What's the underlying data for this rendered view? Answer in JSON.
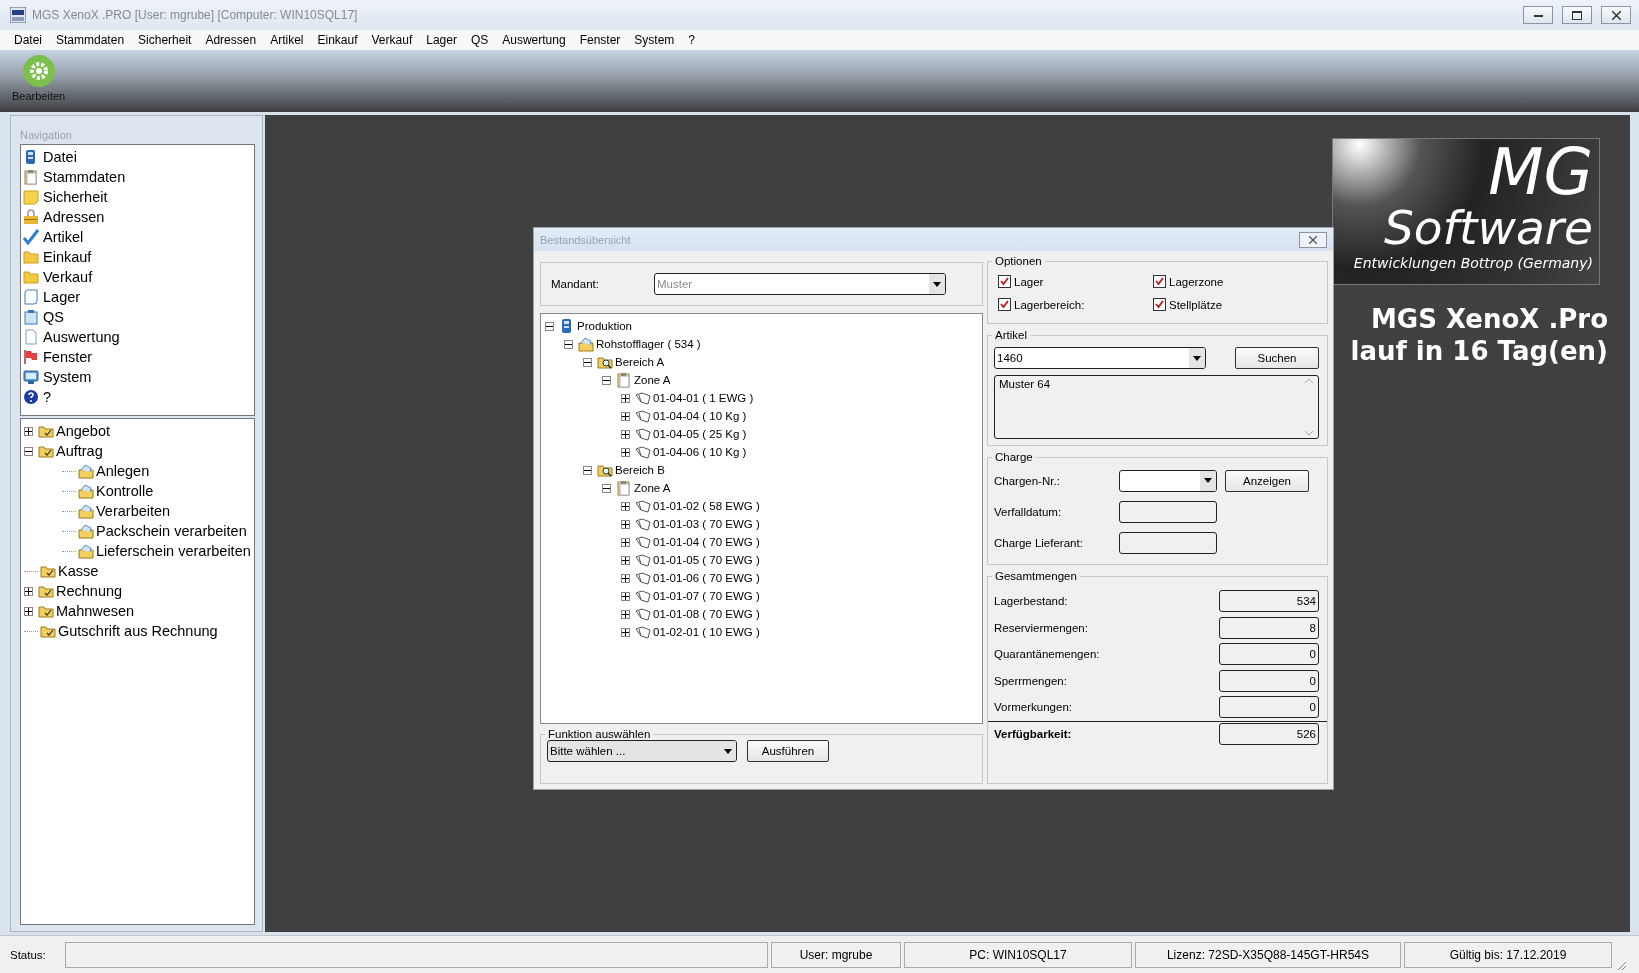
{
  "window": {
    "title": "MGS XenoX .PRO [User: mgrube] [Computer: WIN10SQL17]"
  },
  "menu": [
    {
      "label": "Datei"
    },
    {
      "label": "Stammdaten"
    },
    {
      "label": "Sicherheit"
    },
    {
      "label": "Adressen"
    },
    {
      "label": "Artikel"
    },
    {
      "label": "Einkauf"
    },
    {
      "label": "Verkauf"
    },
    {
      "label": "Lager"
    },
    {
      "label": "QS"
    },
    {
      "label": "Auswertung"
    },
    {
      "label": "Fenster"
    },
    {
      "label": "System"
    },
    {
      "label": "?"
    }
  ],
  "toolbar": [
    {
      "label": "Bearbeiten",
      "kind": "gear"
    }
  ],
  "navigation": {
    "title": "Navigation",
    "items": [
      {
        "label": "Datei",
        "kind": "database"
      },
      {
        "label": "Stammdaten",
        "kind": "clipboard"
      },
      {
        "label": "Sicherheit",
        "kind": "note"
      },
      {
        "label": "Adressen",
        "kind": "lock"
      },
      {
        "label": "Artikel",
        "kind": "check"
      },
      {
        "label": "Einkauf",
        "kind": "folder"
      },
      {
        "label": "Verkauf",
        "kind": "folder"
      },
      {
        "label": "Lager",
        "kind": "scroll"
      },
      {
        "label": "QS",
        "kind": "board"
      },
      {
        "label": "Auswertung",
        "kind": "document"
      },
      {
        "label": "Fenster",
        "kind": "flag"
      },
      {
        "label": "System",
        "kind": "monitor"
      },
      {
        "label": "?",
        "kind": "help"
      }
    ],
    "tree": [
      {
        "label": "Angebot",
        "kind": "folder-check",
        "expanded": false
      },
      {
        "label": "Auftrag",
        "kind": "folder-check",
        "expanded": true,
        "children": [
          {
            "label": "Anlegen",
            "kind": "envelope"
          },
          {
            "label": "Kontrolle",
            "kind": "envelope"
          },
          {
            "label": "Verarbeiten",
            "kind": "envelope"
          },
          {
            "label": "Packschein verarbeiten",
            "kind": "envelope"
          },
          {
            "label": "Lieferschein verarbeiten",
            "kind": "envelope"
          }
        ]
      },
      {
        "label": "Kasse",
        "kind": "folder-check"
      },
      {
        "label": "Rechnung",
        "kind": "folder-check",
        "expanded": false
      },
      {
        "label": "Mahnwesen",
        "kind": "folder-check",
        "expanded": false
      },
      {
        "label": "Gutschrift aus Rechnung",
        "kind": "folder-check"
      }
    ]
  },
  "logo": {
    "line_1": "MG",
    "line_2": "Software",
    "tagline": "Entwicklungen Bottrop (Germany)"
  },
  "banner": [
    "MGS XenoX .Pro",
    "lauf in 16 Tag(en)"
  ],
  "dialog": {
    "title": "Bestandsübersicht",
    "mandant": {
      "label": "Mandant:",
      "value": "Muster",
      "disabled": true
    },
    "tree": [
      {
        "label": "Produktion",
        "kind": "database",
        "expanded": true,
        "children": [
          {
            "label": "Rohstofflager ( 534 )",
            "kind": "envelope",
            "expanded": true,
            "children": [
              {
                "label": "Bereich A",
                "kind": "folder-search",
                "expanded": true,
                "children": [
                  {
                    "label": "Zone A",
                    "kind": "clipboard",
                    "expanded": true,
                    "children": [
                      {
                        "label": "01-04-01 ( 1 EWG )",
                        "kind": "book",
                        "expanded": false
                      },
                      {
                        "label": "01-04-04 ( 10 Kg )",
                        "kind": "book",
                        "expanded": false
                      },
                      {
                        "label": "01-04-05 ( 25 Kg )",
                        "kind": "book",
                        "expanded": false
                      },
                      {
                        "label": "01-04-06 ( 10 Kg )",
                        "kind": "book",
                        "expanded": false
                      }
                    ]
                  }
                ]
              },
              {
                "label": "Bereich B",
                "kind": "folder-search",
                "expanded": true,
                "children": [
                  {
                    "label": "Zone A",
                    "kind": "clipboard",
                    "expanded": true,
                    "children": [
                      {
                        "label": "01-01-02 ( 58 EWG )",
                        "kind": "book",
                        "expanded": false
                      },
                      {
                        "label": "01-01-03 ( 70 EWG )",
                        "kind": "book",
                        "expanded": false
                      },
                      {
                        "label": "01-01-04 ( 70 EWG )",
                        "kind": "book",
                        "expanded": false
                      },
                      {
                        "label": "01-01-05 ( 70 EWG )",
                        "kind": "book",
                        "expanded": false
                      },
                      {
                        "label": "01-01-06 ( 70 EWG )",
                        "kind": "book",
                        "expanded": false
                      },
                      {
                        "label": "01-01-07 ( 70 EWG )",
                        "kind": "book",
                        "expanded": false
                      },
                      {
                        "label": "01-01-08 ( 70 EWG )",
                        "kind": "book",
                        "expanded": false
                      },
                      {
                        "label": "01-02-01 ( 10 EWG )",
                        "kind": "book",
                        "expanded": false
                      }
                    ]
                  }
                ]
              }
            ]
          }
        ]
      }
    ],
    "function": {
      "legend": "Funktion auswählen",
      "value": "Bitte wählen ...",
      "button": "Ausführen"
    },
    "options": {
      "legend": "Optionen",
      "items": [
        {
          "label": "Lager",
          "checked": true
        },
        {
          "label": "Lagerzone",
          "checked": true
        },
        {
          "label": "Lagerbereich:",
          "checked": true
        },
        {
          "label": "Stellplätze",
          "checked": true
        }
      ]
    },
    "article": {
      "legend": "Artikel",
      "value": "1460",
      "button": "Suchen",
      "description": "Muster 64"
    },
    "charge": {
      "legend": "Charge",
      "rows": [
        {
          "label": "Chargen-Nr.:",
          "kind": "combo",
          "button": "Anzeigen"
        },
        {
          "label": "Verfalldatum:",
          "kind": "text"
        },
        {
          "label": "Charge Lieferant:",
          "kind": "text"
        }
      ]
    },
    "totals": {
      "legend": "Gesamtmengen",
      "rows": [
        {
          "label": "Lagerbestand:",
          "value": "534",
          "kind": "normal"
        },
        {
          "label": "Reserviermengen:",
          "value": "8",
          "kind": "normal"
        },
        {
          "label": "Quarantänemengen:",
          "value": "0",
          "kind": "normal"
        },
        {
          "label": "Sperrmengen:",
          "value": "0",
          "kind": "normal"
        },
        {
          "label": "Vormerkungen:",
          "value": "0",
          "kind": "normal"
        },
        {
          "label": "Verfügbarkeit:",
          "value": "526",
          "kind": "total"
        }
      ]
    }
  },
  "status_bar": {
    "label": "Status:",
    "fields": [
      "User: mgrube",
      "PC: WIN10SQL17",
      "Lizenz: 72SD-X35Q88-145GT-HR54S",
      "Gültig bis: 17.12.2019"
    ]
  }
}
